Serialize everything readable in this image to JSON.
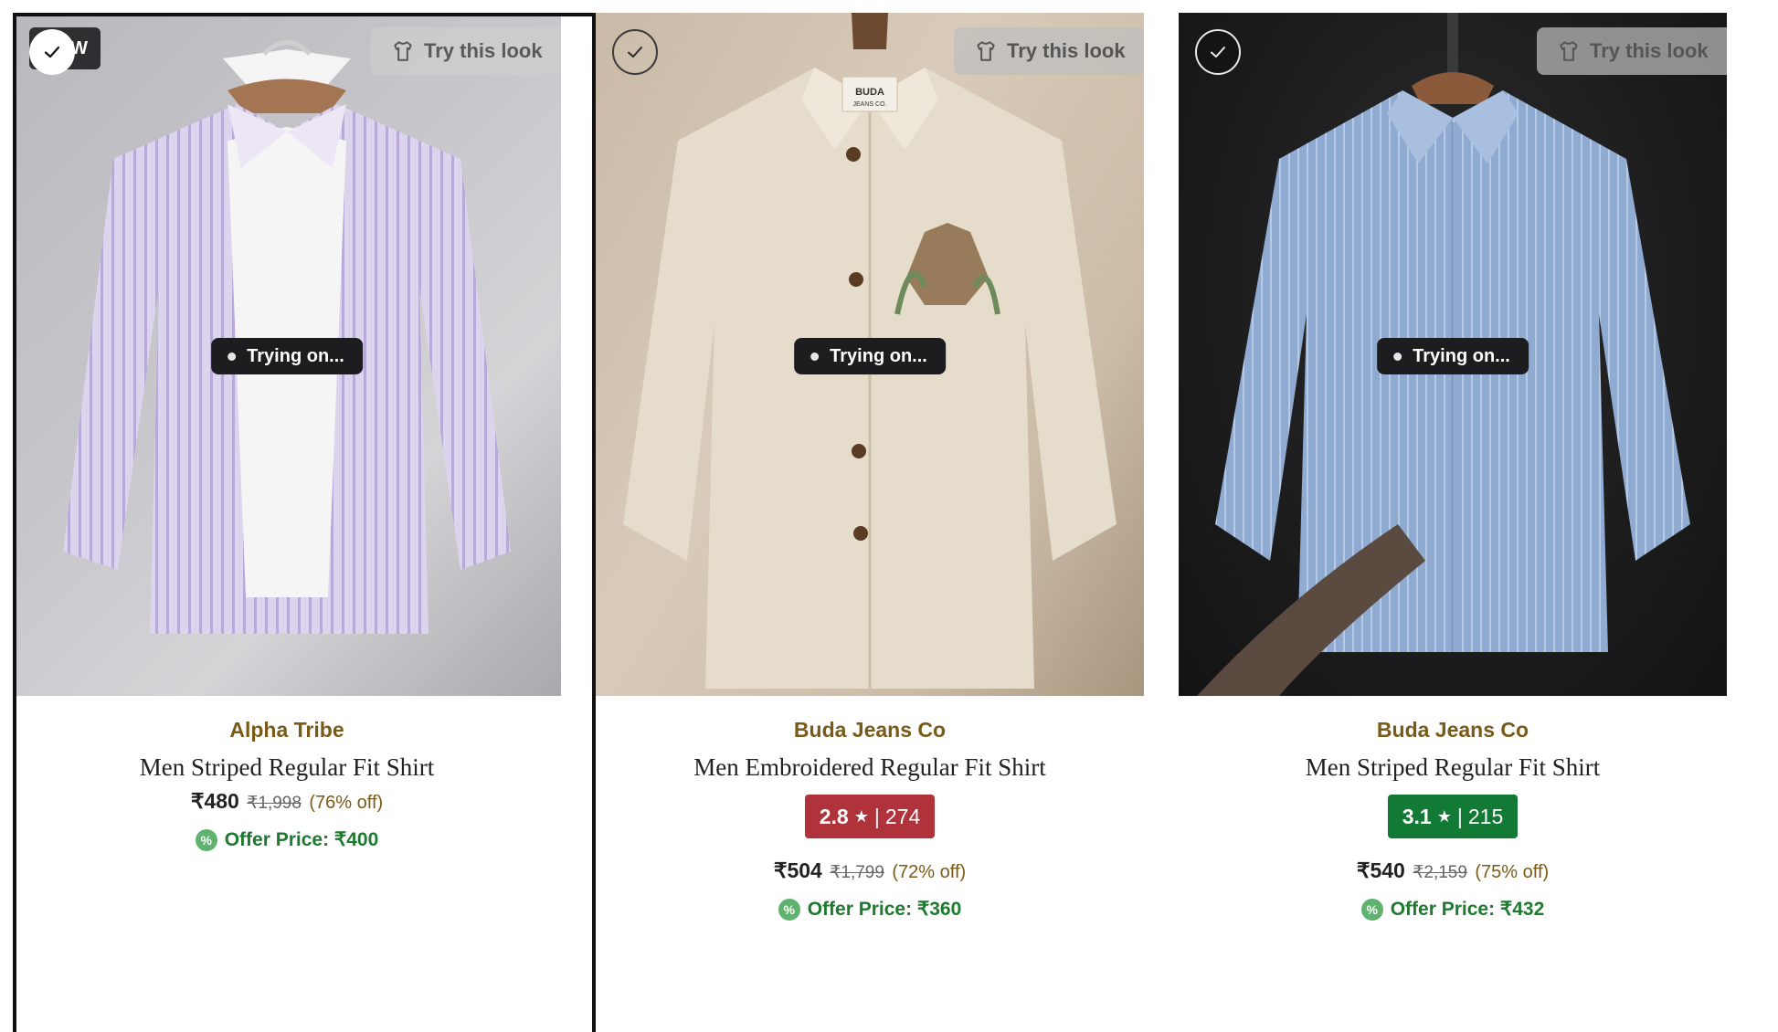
{
  "products": [
    {
      "brand": "Alpha Tribe",
      "title": "Men Striped Regular Fit Shirt",
      "new_tag_fragment": "W",
      "try_label": "Try this look",
      "status": "Trying on...",
      "rating": null,
      "price": "₹480",
      "mrp": "₹1,998",
      "discount": "(76% off)",
      "offer": "Offer Price: ₹400",
      "offer_icon": "%",
      "selected": true
    },
    {
      "brand": "Buda Jeans Co",
      "title": "Men Embroidered Regular Fit Shirt",
      "label_text": "BUDA",
      "label_sub": "JEANS CO.",
      "try_label": "Try this look",
      "status": "Trying on...",
      "rating": {
        "score": "2.8",
        "star": "★",
        "sep": "|",
        "count": "274",
        "color": "#b0323a"
      },
      "price": "₹504",
      "mrp": "₹1,799",
      "discount": "(72% off)",
      "offer": "Offer Price: ₹360",
      "offer_icon": "%",
      "selected": false
    },
    {
      "brand": "Buda Jeans Co",
      "title": "Men Striped Regular Fit Shirt",
      "try_label": "Try this look",
      "status": "Trying on...",
      "rating": {
        "score": "3.1",
        "star": "★",
        "sep": "|",
        "count": "215",
        "color": "#127a35"
      },
      "price": "₹540",
      "mrp": "₹2,159",
      "discount": "(75% off)",
      "offer": "Offer Price: ₹432",
      "offer_icon": "%",
      "selected": false
    }
  ],
  "colors": {
    "brand_text": "#7a5a18",
    "offer_text": "#1e7a2f",
    "selected_border": "#111111"
  },
  "icons": {
    "try": "shirt-icon",
    "select": "check-icon",
    "offer": "percent-badge-icon",
    "status": "dot-icon"
  }
}
